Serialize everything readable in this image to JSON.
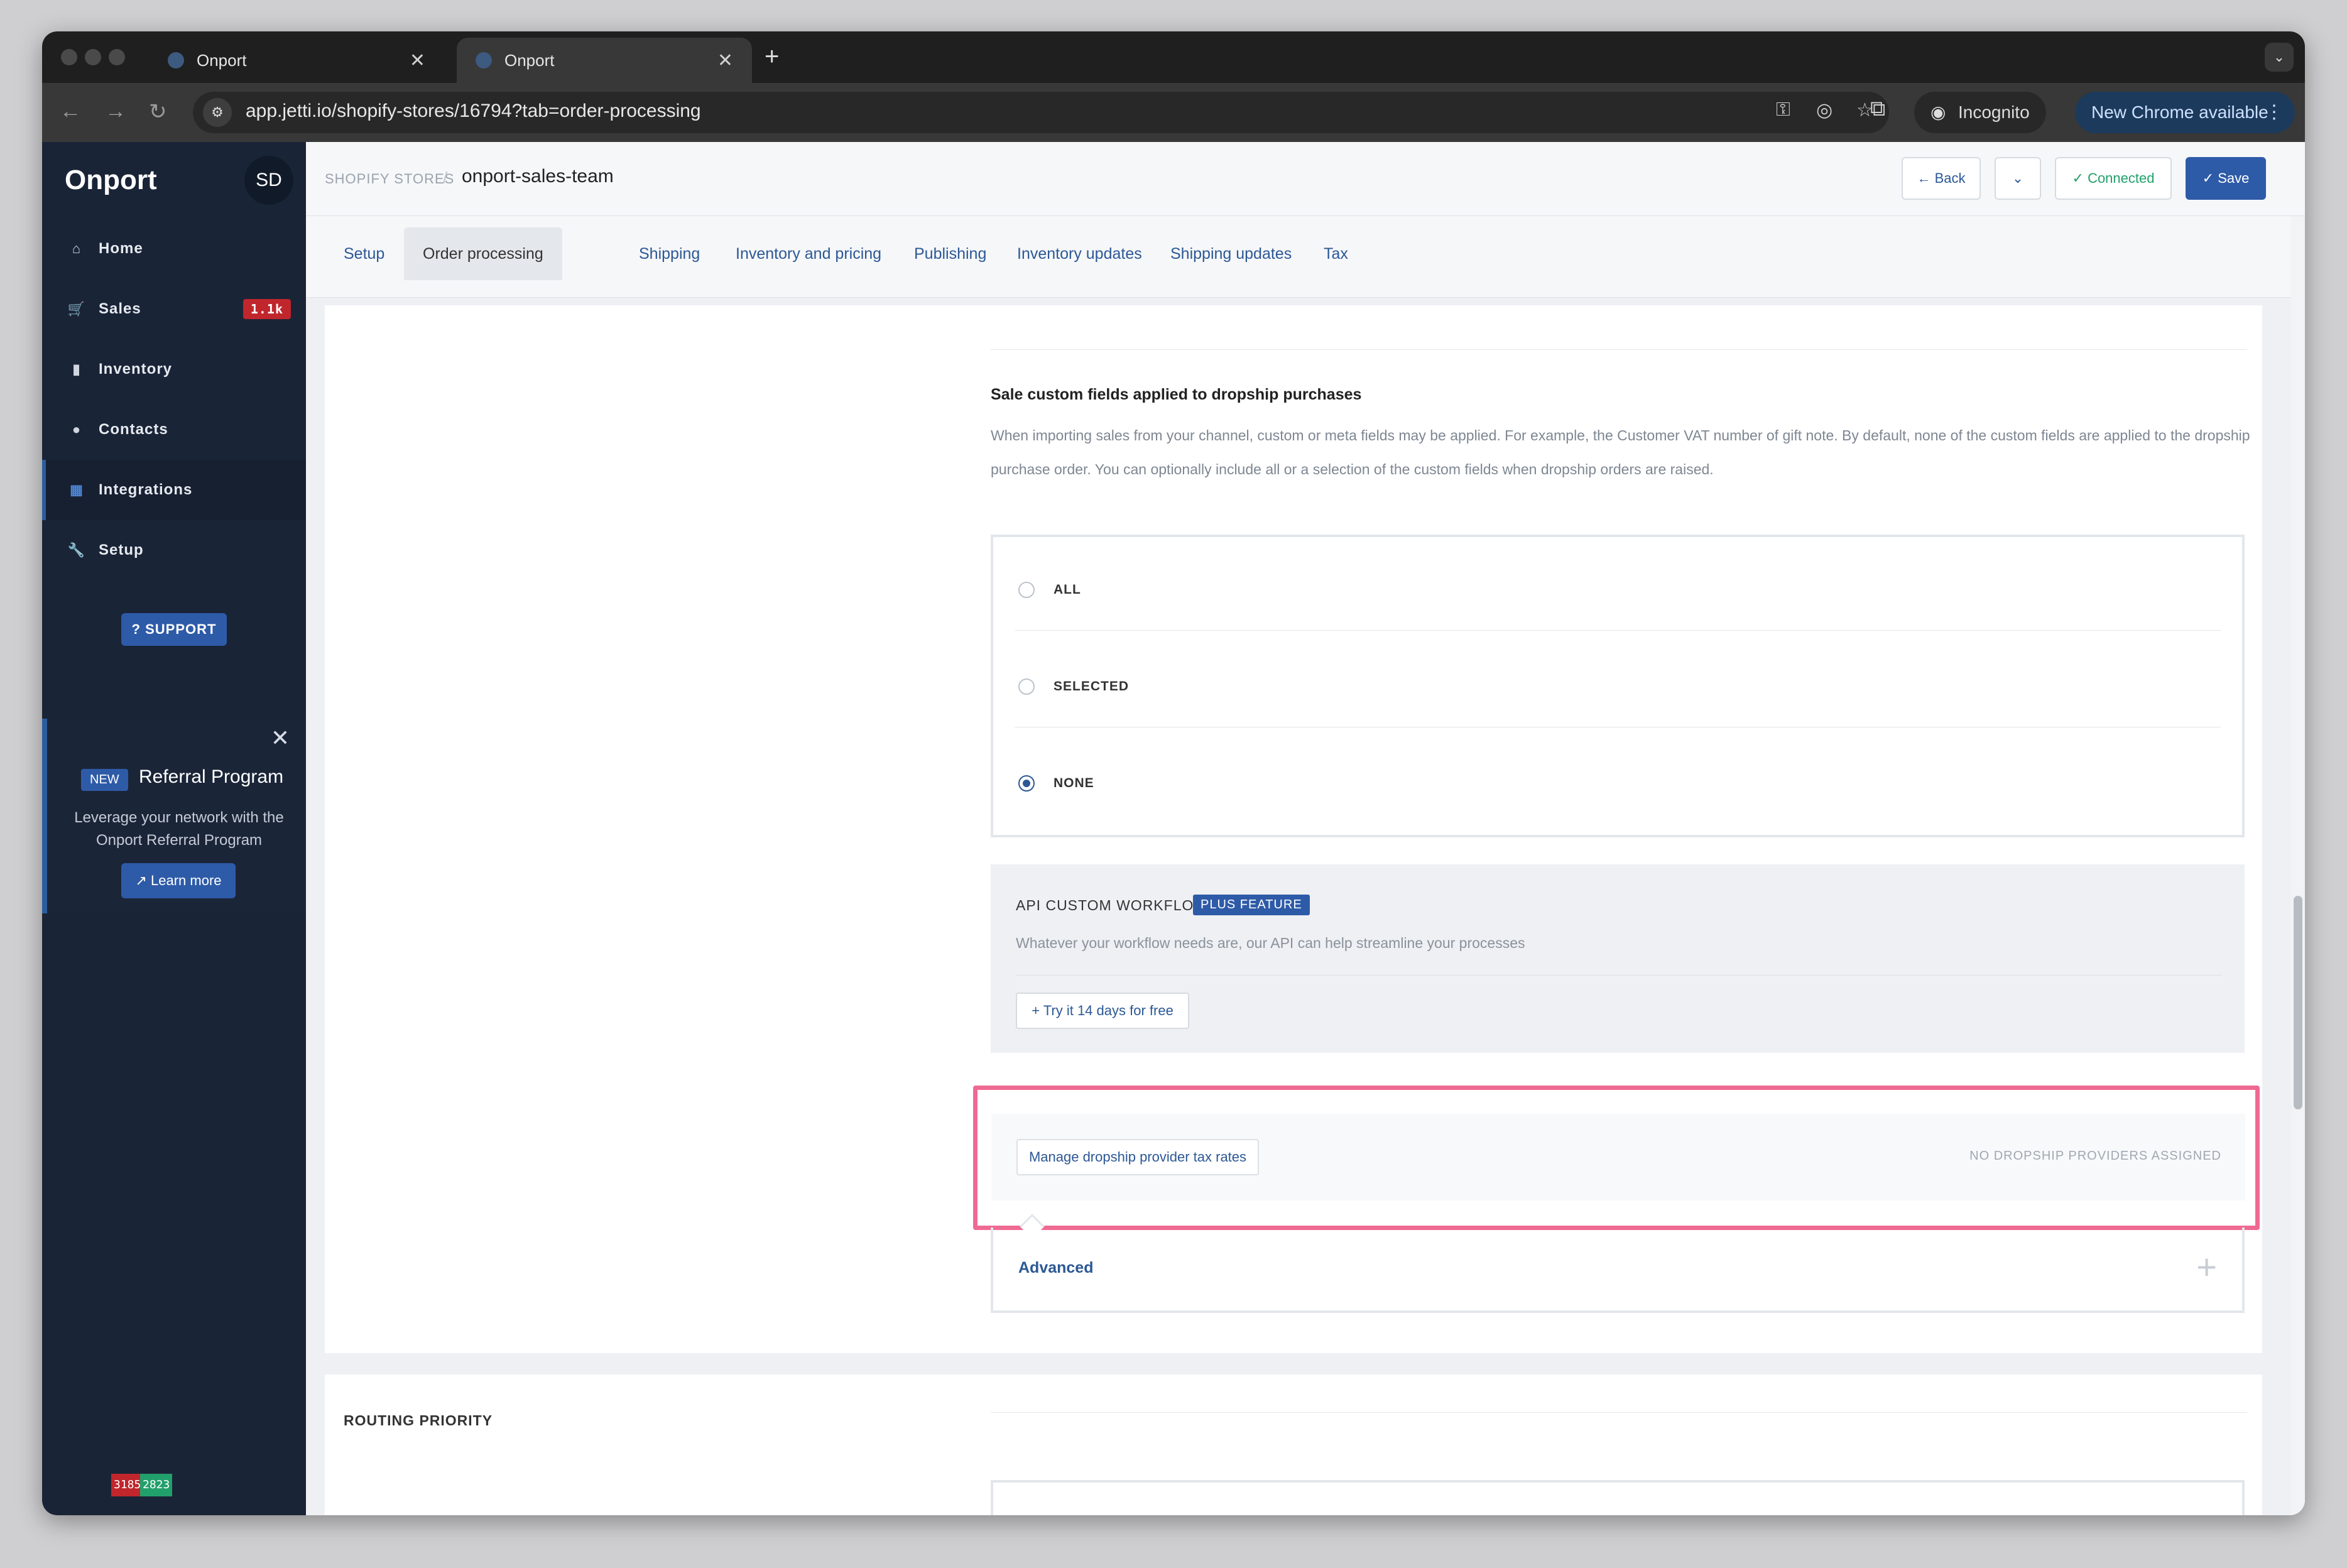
{
  "browser": {
    "tabs": [
      {
        "title": "Onport"
      },
      {
        "title": "Onport"
      }
    ],
    "url": "app.jetti.io/shopify-stores/16794?tab=order-processing",
    "incognito_label": "Incognito",
    "update_label": "New Chrome available"
  },
  "sidebar": {
    "brand": "Onport",
    "avatar": "SD",
    "items": [
      {
        "label": "Home",
        "icon": "home-icon"
      },
      {
        "label": "Sales",
        "icon": "cart-icon",
        "badge": "1.1k"
      },
      {
        "label": "Inventory",
        "icon": "bookmark-icon"
      },
      {
        "label": "Contacts",
        "icon": "user-icon"
      },
      {
        "label": "Integrations",
        "icon": "grid-icon"
      },
      {
        "label": "Setup",
        "icon": "wrench-icon"
      }
    ],
    "support_label": "SUPPORT",
    "referral": {
      "badge": "NEW",
      "title": "Referral Program",
      "description": "Leverage your network with the Onport Referral Program",
      "button": "Learn more"
    },
    "counters": {
      "red": "3185",
      "green": "2823"
    }
  },
  "header": {
    "breadcrumb_parent": "SHOPIFY STORES",
    "breadcrumb_current": "onport-sales-team",
    "back_label": "Back",
    "connected_label": "Connected",
    "save_label": "Save"
  },
  "page_tabs": [
    "Setup",
    "Order processing",
    "Shipping",
    "Inventory and pricing",
    "Publishing",
    "Inventory updates",
    "Shipping updates",
    "Tax"
  ],
  "custom_fields": {
    "title": "Sale custom fields applied to dropship purchases",
    "description": "When importing sales from your channel, custom or meta fields may be applied. For example, the Customer VAT number of gift note. By default, none of the custom fields are applied to the dropship purchase order. You can optionally include all or a selection of the custom fields when dropship orders are raised.",
    "options": [
      "ALL",
      "SELECTED",
      "NONE"
    ],
    "selected": "NONE"
  },
  "api_workflows": {
    "title": "API CUSTOM WORKFLOWS",
    "badge": "PLUS FEATURE",
    "description": "Whatever your workflow needs are, our API can help streamline your processes",
    "button": "Try it 14 days for free"
  },
  "tax_rates": {
    "button": "Manage dropship provider tax rates",
    "status": "NO DROPSHIP PROVIDERS ASSIGNED"
  },
  "advanced_label": "Advanced",
  "routing_title": "ROUTING PRIORITY",
  "colors": {
    "accent": "#2e5ba8",
    "highlight": "#ef6a93",
    "sidebar": "#1a2437"
  }
}
